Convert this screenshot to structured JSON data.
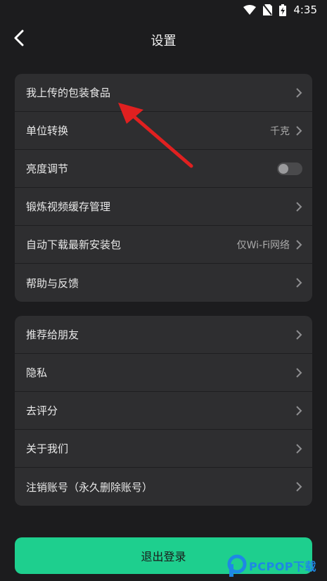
{
  "status_bar": {
    "time": "4:35"
  },
  "header": {
    "title": "设置"
  },
  "group1": [
    {
      "label": "我上传的包装食品",
      "value": ""
    },
    {
      "label": "单位转换",
      "value": "千克"
    },
    {
      "label": "亮度调节",
      "toggle": false
    },
    {
      "label": "锻炼视频缓存管理",
      "value": ""
    },
    {
      "label": "自动下载最新安装包",
      "value": "仅Wi-Fi网络"
    },
    {
      "label": "帮助与反馈",
      "value": ""
    }
  ],
  "group2": [
    {
      "label": "推荐给朋友"
    },
    {
      "label": "隐私"
    },
    {
      "label": "去评分"
    },
    {
      "label": "关于我们"
    },
    {
      "label": "注销账号（永久删除账号）"
    }
  ],
  "logout_label": "退出登录",
  "watermark_text": "PCPOP下载",
  "colors": {
    "background": "#1c1c1e",
    "card": "#2e2e30",
    "accent": "#1ecf8e",
    "annotation": "#e02020"
  }
}
